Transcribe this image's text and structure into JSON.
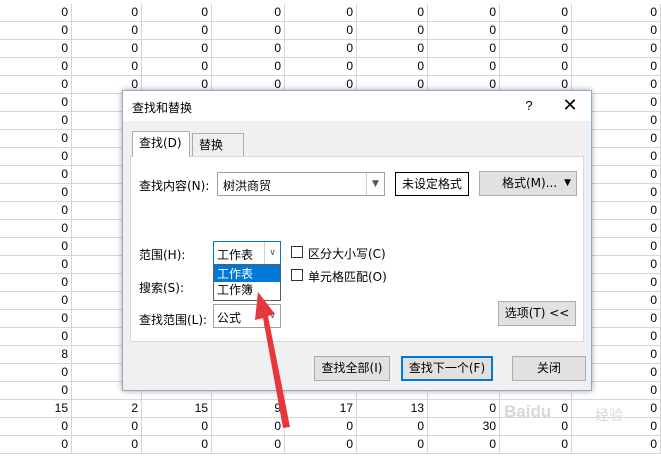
{
  "sheet": {
    "rows": [
      [
        "0",
        "0",
        "0",
        "0",
        "0",
        "0",
        "0",
        "0",
        "0"
      ],
      [
        "0",
        "0",
        "0",
        "0",
        "0",
        "0",
        "0",
        "0",
        "0"
      ],
      [
        "0",
        "0",
        "0",
        "0",
        "0",
        "0",
        "0",
        "0",
        "0"
      ],
      [
        "0",
        "0",
        "0",
        "0",
        "0",
        "0",
        "0",
        "0",
        "0"
      ],
      [
        "0",
        "0",
        "0",
        "0",
        "0",
        "0",
        "0",
        "0",
        "0"
      ],
      [
        "0",
        "",
        "",
        "",
        "",
        "",
        "",
        "",
        "0"
      ],
      [
        "0",
        "",
        "",
        "",
        "",
        "",
        "",
        "",
        "0"
      ],
      [
        "0",
        "",
        "",
        "",
        "",
        "",
        "",
        "",
        "0"
      ],
      [
        "0",
        "",
        "",
        "",
        "",
        "",
        "",
        "",
        "0"
      ],
      [
        "0",
        "",
        "",
        "",
        "",
        "",
        "",
        "",
        "0"
      ],
      [
        "0",
        "",
        "",
        "",
        "",
        "",
        "",
        "",
        "0"
      ],
      [
        "0",
        "",
        "",
        "",
        "",
        "",
        "",
        "",
        "0"
      ],
      [
        "0",
        "",
        "",
        "",
        "",
        "",
        "",
        "",
        "0"
      ],
      [
        "0",
        "",
        "",
        "",
        "",
        "",
        "",
        "",
        "0"
      ],
      [
        "0",
        "",
        "",
        "",
        "",
        "",
        "",
        "",
        "0"
      ],
      [
        "0",
        "",
        "",
        "",
        "",
        "",
        "",
        "",
        "0"
      ],
      [
        "0",
        "",
        "",
        "",
        "",
        "",
        "",
        "",
        "0"
      ],
      [
        "0",
        "",
        "",
        "",
        "",
        "",
        "",
        "",
        "0"
      ],
      [
        "0",
        "",
        "",
        "",
        "",
        "",
        "",
        "",
        "0"
      ],
      [
        "8",
        "",
        "",
        "",
        "",
        "",
        "",
        "",
        "0"
      ],
      [
        "0",
        "",
        "",
        "",
        "",
        "",
        "",
        "",
        "0"
      ],
      [
        "0",
        "",
        "",
        "",
        "",
        "",
        "",
        "",
        "0"
      ],
      [
        "15",
        "2",
        "15",
        "9",
        "17",
        "13",
        "0",
        "0",
        "0"
      ],
      [
        "0",
        "0",
        "0",
        "0",
        "0",
        "0",
        "30",
        "0",
        "0"
      ],
      [
        "0",
        "0",
        "0",
        "0",
        "0",
        "0",
        "0",
        "0",
        "0"
      ]
    ]
  },
  "dialog": {
    "title": "查找和替换",
    "help": "?",
    "close_glyph": "✕",
    "tabs": {
      "find": "查找(D)",
      "replace": "替换(P)"
    },
    "find_label": "查找内容(N):",
    "find_value": "树洪商贸",
    "format_preview": "未设定格式",
    "format_button": "格式(M)...",
    "scope_label": "范围(H):",
    "scope_value": "工作表",
    "scope_options": [
      "工作表",
      "工作簿"
    ],
    "search_label": "搜索(S):",
    "lookin_label": "查找范围(L):",
    "lookin_value": "公式",
    "match_case": "区分大小写(C)",
    "match_cell": "单元格匹配(O)",
    "options_button": "选项(T) <<",
    "find_all_button": "查找全部(I)",
    "find_next_button": "查找下一个(F)",
    "close_button": "关闭"
  },
  "annotation_color": "#e8373b",
  "watermark": "Baidu",
  "watermark_sub": "经验"
}
